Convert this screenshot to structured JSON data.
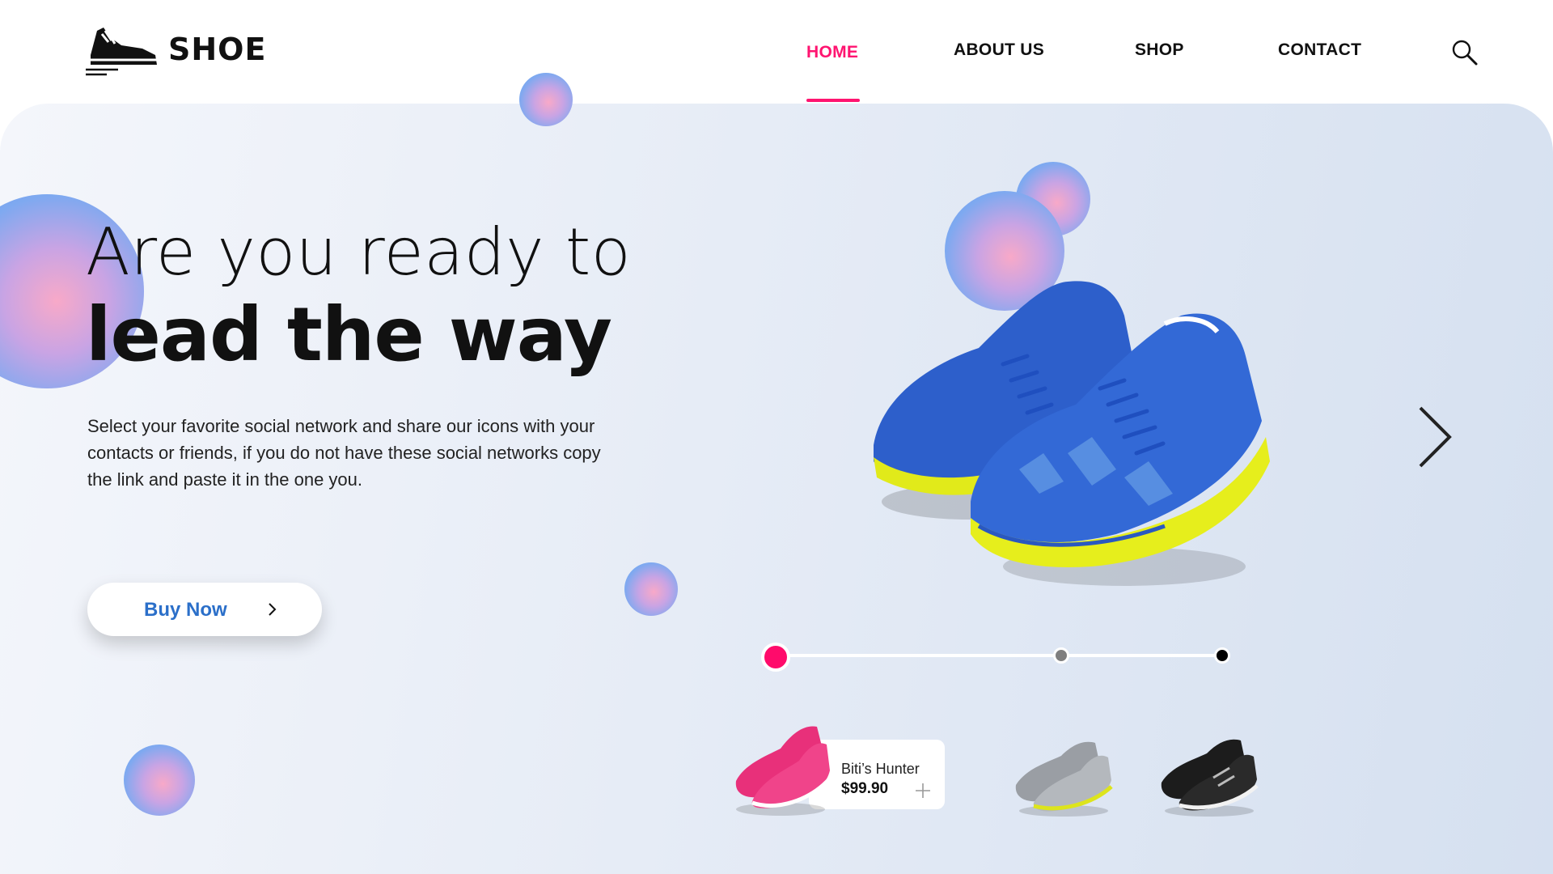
{
  "brand": {
    "name": "SHOE",
    "logo_icon": "sneaker-icon"
  },
  "nav": {
    "items": [
      {
        "label": "HOME",
        "active": true
      },
      {
        "label": "ABOUT US",
        "active": false
      },
      {
        "label": "SHOP",
        "active": false
      },
      {
        "label": "CONTACT",
        "active": false
      }
    ],
    "search_icon": "search-icon"
  },
  "hero": {
    "headline_light": "Are you ready to",
    "headline_bold": "lead the way",
    "description": "Select your favorite social network and share our icons with your contacts or friends, if you do not have these social networks copy the link and paste it in the one you.",
    "cta_label": "Buy Now",
    "next_icon": "chevron-right-icon"
  },
  "slider": {
    "count": 3,
    "active_index": 0
  },
  "products": [
    {
      "name": "Biti’s Hunter",
      "price": "$99.90",
      "color": "#e8307a",
      "selected": true
    },
    {
      "color": "#9a9ea4",
      "selected": false
    },
    {
      "color": "#1c1c1c",
      "selected": false
    }
  ],
  "colors": {
    "accent": "#ff1470",
    "cta_text": "#2b6fc9",
    "shoe_main": "#2f63d0",
    "sole_main": "#e6ee1c"
  }
}
